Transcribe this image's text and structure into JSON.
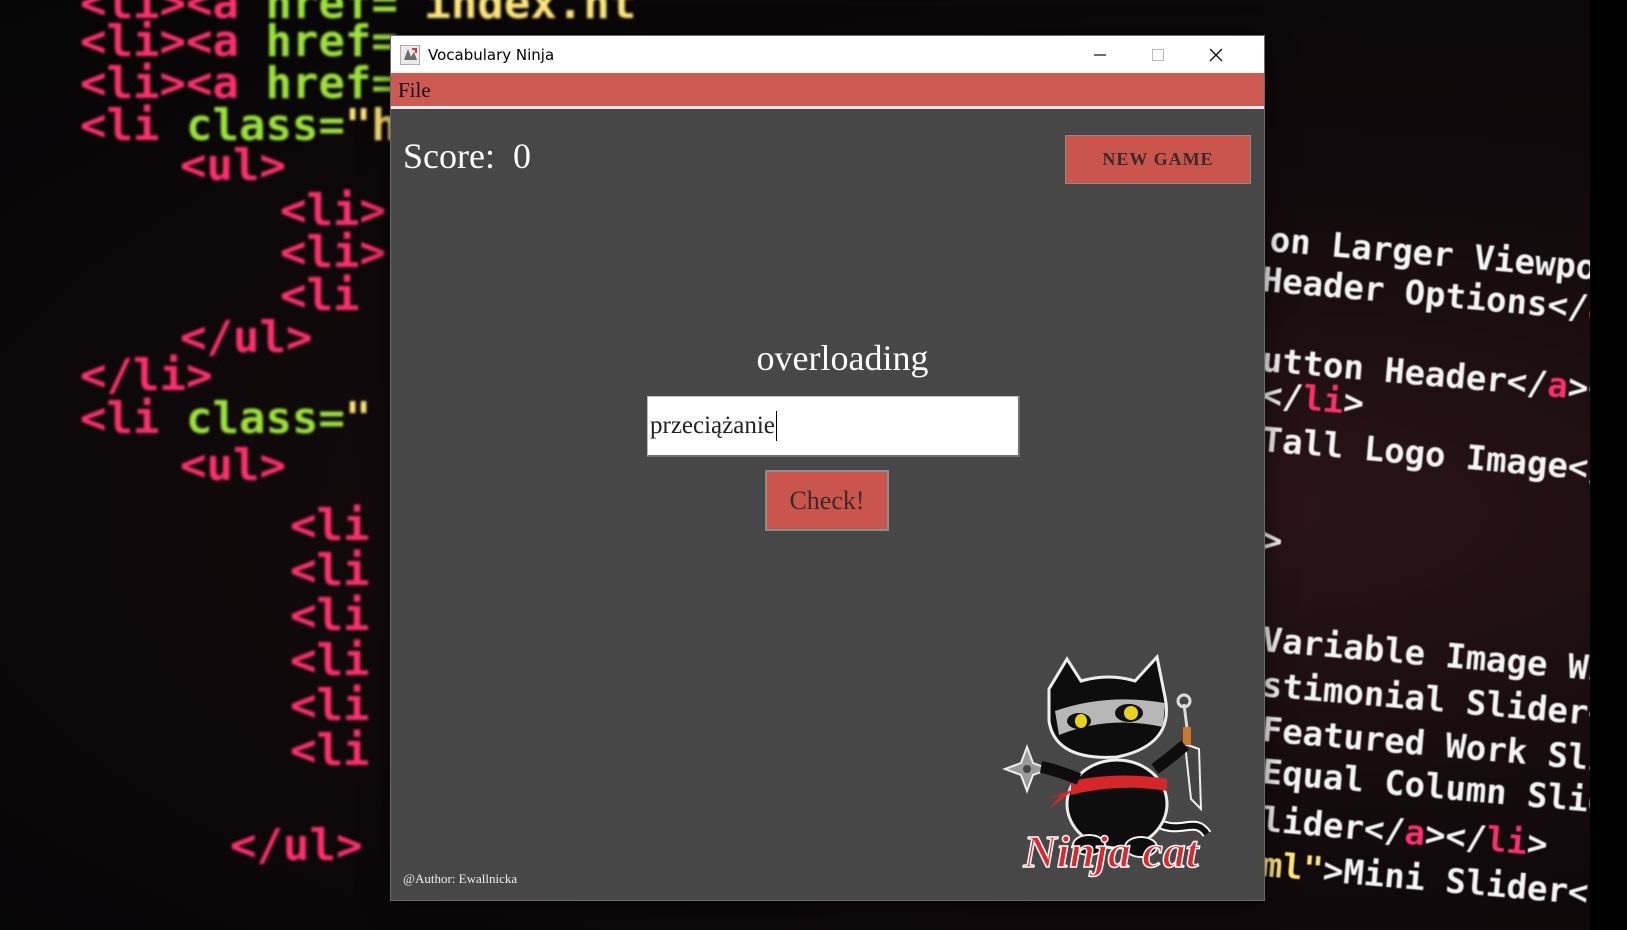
{
  "wallpaper": {
    "left_lines": [
      {
        "parts": [
          [
            "<",
            "tag"
          ],
          [
            "li><a ",
            "tag"
          ],
          [
            "href=",
            "attr"
          ],
          [
            "\"index.ht",
            "str"
          ]
        ]
      },
      {
        "parts": [
          [
            "<li><a ",
            "tag"
          ],
          [
            "href=",
            "attr"
          ]
        ]
      },
      {
        "parts": [
          [
            "<li><a ",
            "tag"
          ],
          [
            "href=",
            "attr"
          ]
        ]
      },
      {
        "parts": [
          [
            "<li ",
            "tag"
          ],
          [
            "class=",
            "attr"
          ],
          [
            "\"h",
            "str"
          ]
        ]
      },
      {
        "parts": [
          [
            "<ul>",
            "tag"
          ]
        ]
      },
      {
        "parts": [
          [
            "<li>",
            "tag"
          ]
        ]
      },
      {
        "parts": [
          [
            "<li>",
            "tag"
          ]
        ]
      },
      {
        "parts": [
          [
            "<li",
            "tag"
          ]
        ]
      },
      {
        "parts": [
          [
            "</ul>",
            "tag"
          ]
        ]
      },
      {
        "parts": [
          [
            "</li>",
            "tag"
          ]
        ]
      },
      {
        "parts": [
          [
            "<li ",
            "tag"
          ],
          [
            "class=",
            "attr"
          ],
          [
            "\"",
            "str"
          ]
        ]
      },
      {
        "parts": [
          [
            "<ul>",
            "tag"
          ]
        ]
      },
      {
        "parts": [
          [
            "<li",
            "tag"
          ]
        ]
      },
      {
        "parts": [
          [
            "<li",
            "tag"
          ]
        ]
      },
      {
        "parts": [
          [
            "<li",
            "tag"
          ]
        ]
      },
      {
        "parts": [
          [
            "<li",
            "tag"
          ]
        ]
      },
      {
        "parts": [
          [
            "<li",
            "tag"
          ]
        ]
      },
      {
        "parts": [
          [
            "<li",
            "tag"
          ]
        ]
      },
      {
        "parts": [
          [
            "</ul>",
            "tag"
          ]
        ]
      }
    ],
    "right_lines": [
      {
        "parts": [
          [
            "on Larger Viewports",
            "plain"
          ]
        ]
      },
      {
        "parts": [
          [
            "Header Options</",
            "plain"
          ],
          [
            "a",
            "tag"
          ],
          [
            ">",
            "plain"
          ]
        ]
      },
      {
        "parts": [
          [
            "utton Header</",
            "plain"
          ],
          [
            "a",
            "tag"
          ],
          [
            "></",
            "plain"
          ],
          [
            "li",
            "tag"
          ]
        ]
      },
      {
        "parts": [
          [
            "</",
            "plain"
          ],
          [
            "li",
            "tag"
          ],
          [
            ">",
            "plain"
          ]
        ]
      },
      {
        "parts": [
          [
            "Tall Logo Image</",
            "plain"
          ],
          [
            "a",
            "tag"
          ]
        ]
      },
      {
        "parts": [
          [
            ">",
            "plain"
          ]
        ]
      },
      {
        "parts": [
          [
            "Variable Image Wi",
            "plain"
          ]
        ]
      },
      {
        "parts": [
          [
            "stimonial Slider</",
            "plain"
          ]
        ]
      },
      {
        "parts": [
          [
            "Featured Work Sli",
            "plain"
          ]
        ]
      },
      {
        "parts": [
          [
            "Equal Column Slid",
            "plain"
          ]
        ]
      },
      {
        "parts": [
          [
            "lider</",
            "plain"
          ],
          [
            "a",
            "tag"
          ],
          [
            "></",
            "plain"
          ],
          [
            "li",
            "tag"
          ],
          [
            ">",
            "plain"
          ]
        ]
      },
      {
        "parts": [
          [
            "ml\"",
            "str"
          ],
          [
            ">Mini Slider<",
            "plain"
          ]
        ]
      }
    ]
  },
  "window": {
    "title": "Vocabulary Ninja",
    "controls": {
      "minimize": "minimize",
      "maximize": "maximize",
      "close": "close"
    }
  },
  "menu": {
    "file_label": "File"
  },
  "game": {
    "score_label": "Score:",
    "score_value": "0",
    "new_game_label": "NEW GAME",
    "word": "overloading",
    "answer_value": "przeciążanie",
    "check_label": "Check!",
    "author": "@Author: Ewallnicka"
  },
  "logo": {
    "text": "Ninja cat"
  },
  "colors": {
    "accent": "#cd5a52",
    "panel": "#474747",
    "title_bar": "#ffffff"
  }
}
